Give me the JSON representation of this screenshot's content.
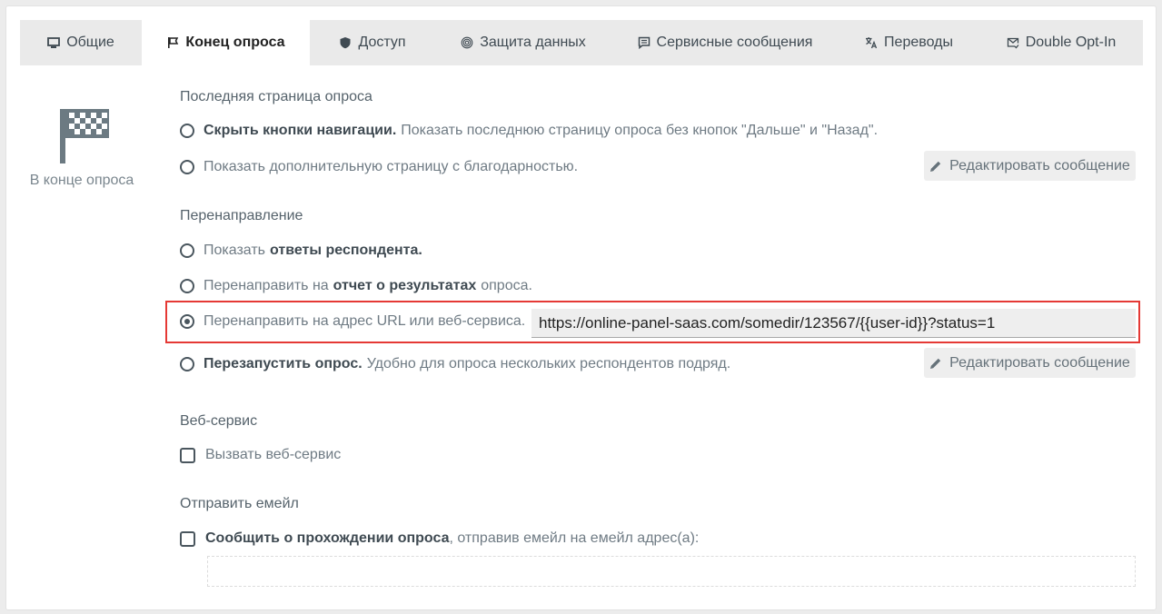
{
  "tabs": [
    {
      "label": "Общие",
      "icon": "monitor-icon"
    },
    {
      "label": "Конец опроса",
      "icon": "flag-icon",
      "active": true
    },
    {
      "label": "Доступ",
      "icon": "shield-icon"
    },
    {
      "label": "Защита данных",
      "icon": "fingerprint-icon"
    },
    {
      "label": "Сервисные сообщения",
      "icon": "message-icon"
    },
    {
      "label": "Переводы",
      "icon": "translate-icon"
    },
    {
      "label": "Double Opt-In",
      "icon": "mail-check-icon"
    }
  ],
  "sidebar": {
    "icon": "checkered-flag-icon",
    "label": "В конце опроса"
  },
  "last_page": {
    "title": "Последняя страница опроса",
    "option1_bold": "Скрыть кнопки навигации.",
    "option1_text": "Показать последнюю страницу опроса без кнопок \"Дальше\" и \"Назад\".",
    "option2_text": "Показать дополнительную страницу с благодарностью.",
    "edit_button": "Редактировать сообщение"
  },
  "redirect": {
    "title": "Перенаправление",
    "option1_text": "Показать",
    "option1_bold": "ответы респондента.",
    "option2_text": "Перенаправить на",
    "option2_bold": "отчет о результатах",
    "option2_tail": "опроса.",
    "option3_text": "Перенаправить на адрес URL или веб-сервиса.",
    "url_value": "https://online-panel-saas.com/somedir/123567/{{user-id}}?status=1",
    "option4_bold": "Перезапустить опрос.",
    "option4_text": "Удобно для опроса нескольких респондентов подряд.",
    "edit_button": "Редактировать сообщение"
  },
  "webservice": {
    "title": "Веб-сервис",
    "checkbox_label": "Вызвать веб-сервис"
  },
  "email": {
    "title": "Отправить емейл",
    "checkbox_bold": "Сообщить о прохождении опроса",
    "checkbox_text": ", отправив емейл на емейл адрес(а):",
    "input_value": ""
  },
  "colors": {
    "highlight": "#e53935",
    "active_tab_bg": "#ffffff",
    "tabbar_bg": "#eaeaea"
  }
}
